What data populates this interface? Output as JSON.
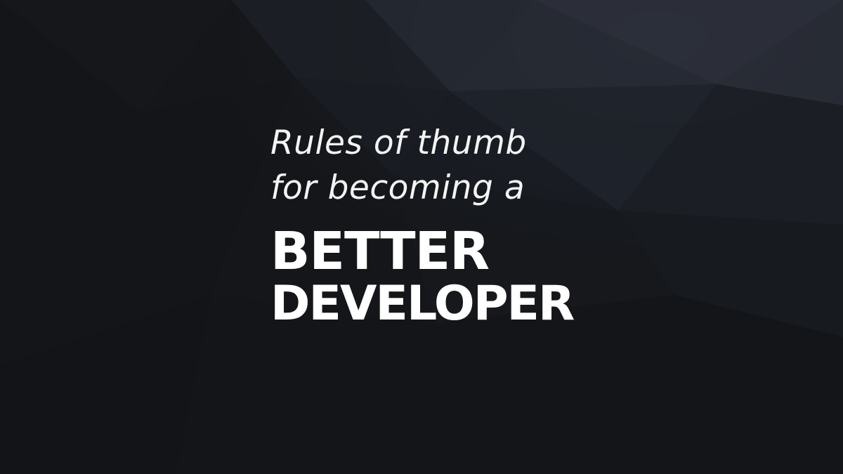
{
  "headline": {
    "line1": "Rules of thumb",
    "line2": "for becoming a",
    "line3": "BETTER",
    "line4": "DEVELOPER"
  },
  "colors": {
    "background": "#141619",
    "polygon_light": "#2b2f3a",
    "polygon_mid": "#20242d",
    "polygon_dark": "#181b21",
    "text": "#ffffff"
  }
}
